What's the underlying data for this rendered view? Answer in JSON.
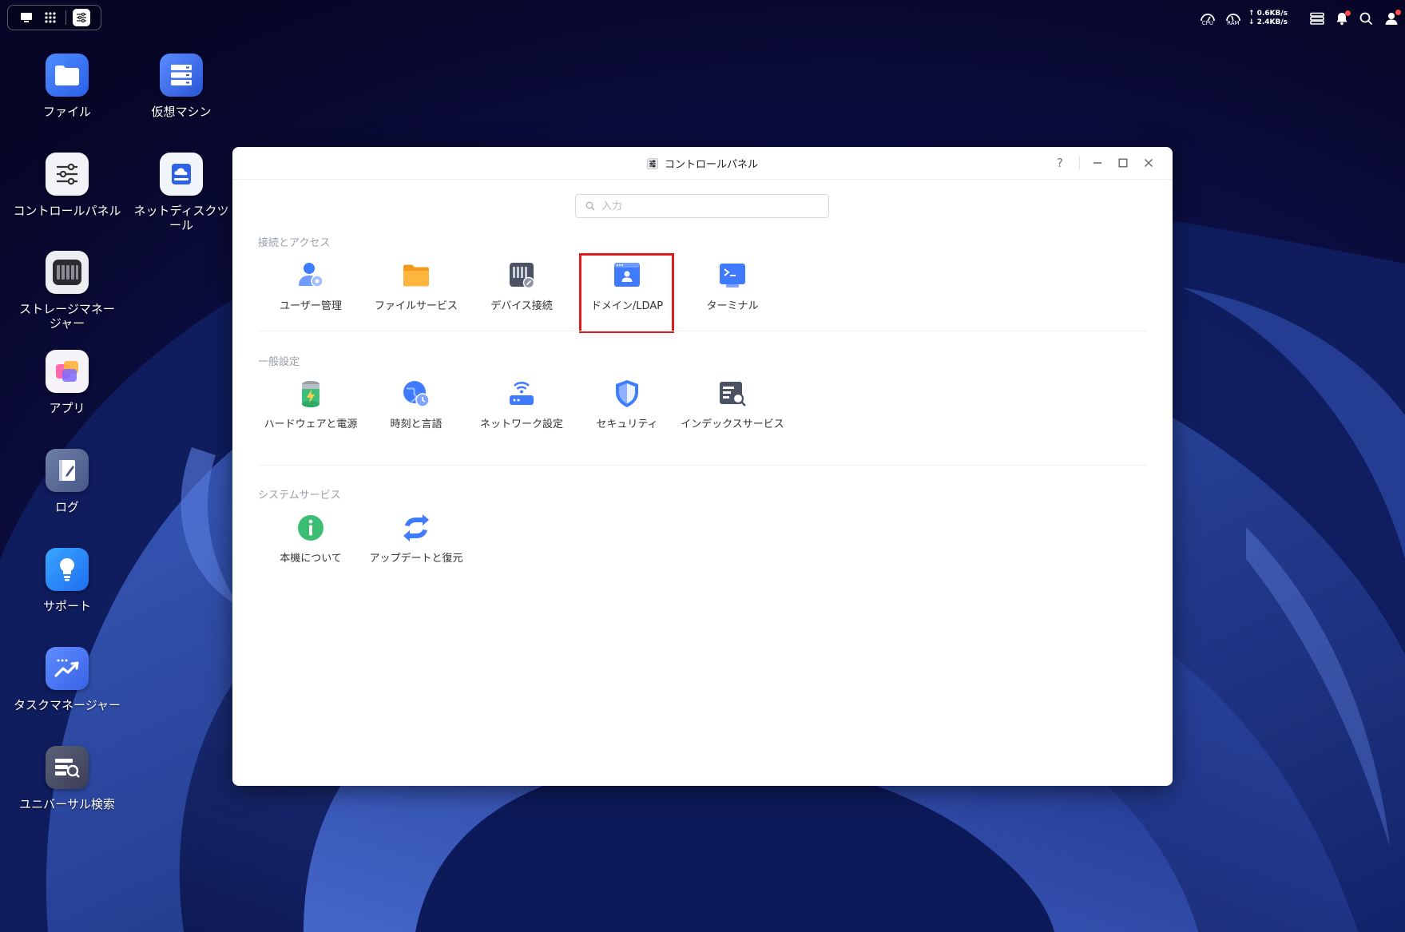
{
  "topbar": {
    "cpu_label": "CPU",
    "ram_label": "RAM",
    "upload_speed": "↑ 0.6KB/s",
    "download_speed": "↓ 2.4KB/s"
  },
  "desktop": {
    "icons": [
      {
        "label": "ファイル"
      },
      {
        "label": "仮想マシン"
      },
      {
        "label": "コントロールパネル"
      },
      {
        "label": "ネットディスクツール"
      },
      {
        "label": "ストレージマネージャー"
      },
      {
        "label": "アプリ"
      },
      {
        "label": "ログ"
      },
      {
        "label": "サポート"
      },
      {
        "label": "タスクマネージャー"
      },
      {
        "label": "ユニバーサル検索"
      }
    ]
  },
  "window": {
    "title": "コントロールパネル",
    "help": "?",
    "search_placeholder": "入力",
    "sections": [
      {
        "title": "接続とアクセス",
        "items": [
          {
            "label": "ユーザー管理"
          },
          {
            "label": "ファイルサービス"
          },
          {
            "label": "デバイス接続"
          },
          {
            "label": "ドメイン/LDAP"
          },
          {
            "label": "ターミナル"
          }
        ]
      },
      {
        "title": "一般設定",
        "items": [
          {
            "label": "ハードウェアと電源"
          },
          {
            "label": "時刻と言語"
          },
          {
            "label": "ネットワーク設定"
          },
          {
            "label": "セキュリティ"
          },
          {
            "label": "インデックスサービス"
          }
        ]
      },
      {
        "title": "システムサービス",
        "items": [
          {
            "label": "本機について"
          },
          {
            "label": "アップデートと復元"
          }
        ]
      }
    ]
  }
}
